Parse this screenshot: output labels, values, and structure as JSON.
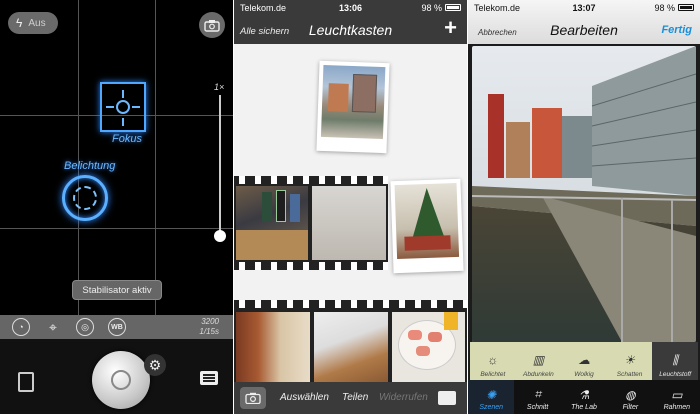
{
  "camera": {
    "flash_label": "Aus",
    "focus_label": "Fokus",
    "exposure_label": "Belichtung",
    "zoom_label": "1×",
    "stabilizer_label": "Stabilisator aktiv",
    "iso_value": "3200",
    "shutter_value": "1/15s",
    "wb_label": "WB",
    "icons": [
      "lightning-icon",
      "camera-switch-icon",
      "aperture-icon",
      "crosshair-icon",
      "shutter-speed-icon",
      "white-balance-icon",
      "film-icon",
      "gear-icon",
      "menu-icon"
    ]
  },
  "lightbox": {
    "status": {
      "carrier": "Telekom.de",
      "time": "13:06",
      "battery": "98 %"
    },
    "save_all": "Alle sichern",
    "title": "Leuchtkasten",
    "add_symbol": "+",
    "bottom": {
      "select": "Auswählen",
      "share": "Teilen",
      "undo": "Widerrufen"
    }
  },
  "editor": {
    "status": {
      "carrier": "Telekom.de",
      "time": "13:07",
      "battery": "98 %"
    },
    "cancel": "Abbrechen",
    "title": "Bearbeiten",
    "done": "Fertig",
    "tools": [
      {
        "label": "Belichtet",
        "icon": "sun-icon"
      },
      {
        "label": "Abdunkeln",
        "icon": "building-icon"
      },
      {
        "label": "Wolkig",
        "icon": "cloud-icon"
      },
      {
        "label": "Schatten",
        "icon": "shade-icon"
      },
      {
        "label": "Leuchtstoff",
        "icon": "fluorescent-icon"
      }
    ],
    "tabs": [
      {
        "label": "Szenen",
        "icon": "scenes-icon"
      },
      {
        "label": "Schnitt",
        "icon": "crop-icon"
      },
      {
        "label": "The Lab",
        "icon": "lab-icon"
      },
      {
        "label": "Filter",
        "icon": "filter-icon"
      },
      {
        "label": "Rahmen",
        "icon": "frame-icon"
      }
    ],
    "accent": "#1a8fd8"
  }
}
